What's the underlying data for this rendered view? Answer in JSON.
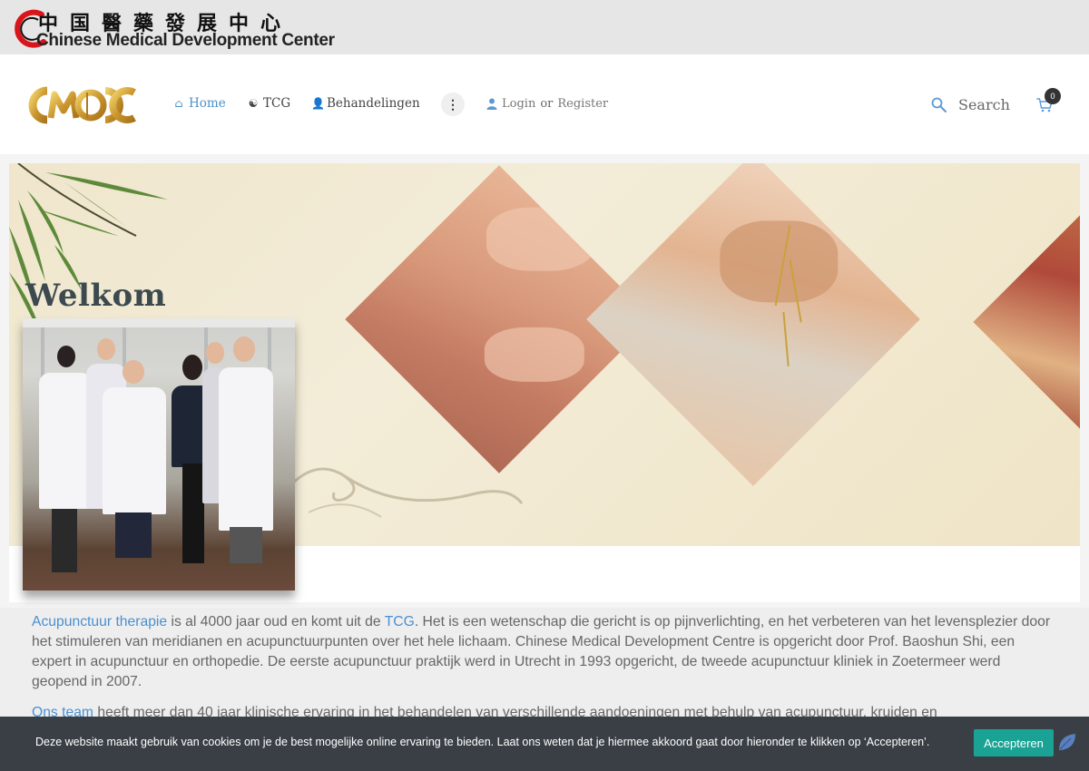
{
  "topbar": {
    "chinese_name": "中国醫藥發展中心",
    "english_name": "Chinese Medical Development Center"
  },
  "nav": {
    "logo_text": "CMDC",
    "items": [
      {
        "label": "Home",
        "icon": "home-icon",
        "active": true
      },
      {
        "label": "TCG",
        "icon": "yin-yang-icon",
        "active": false
      },
      {
        "label": "Behandelingen",
        "icon": "user-icon",
        "active": false
      }
    ],
    "more_icon": "vertical-dots-icon",
    "login_label": "Login",
    "or_label": "or",
    "register_label": "Register",
    "search_label": "Search",
    "cart_count": "0"
  },
  "hero": {
    "welcome_title": "Welkom"
  },
  "content": {
    "para1_link1": "Acupunctuur therapie",
    "para1_text1": " is al 4000 jaar oud en komt uit de ",
    "para1_link2": "TCG",
    "para1_text2": ". Het is een wetenschap die gericht is op pijnverlichting, en het verbeteren van het levensplezier door het stimuleren van meridianen en acupunctuurpunten over het hele lichaam. Chinese Medical Development Centre is opgericht door Prof. Baoshun Shi, een expert in acupunctuur en orthopedie. De eerste acupunctuur praktijk werd in Utrecht in 1993 opgericht,  de tweede acupunctuur kliniek in Zoetermeer werd geopend in 2007.",
    "para2_link": "Ons team",
    "para2_text": " heeft meer dan 40 jaar klinische ervaring in het behandelen van verschillende aandoeningen met behulp van acupunctuur, kruiden en"
  },
  "cookie": {
    "message": "Deze website maakt gebruik van cookies om je de best mogelijke online ervaring te bieden. Laat ons weten dat je hiermee akkoord gaat door hieronder te klikken op ‘Accepteren’.",
    "accept_label": "Accepteren"
  },
  "colors": {
    "accent": "#4a90c8",
    "cookie_bg": "#3a3f45",
    "cookie_btn": "#1aa394",
    "brand_red": "#d9141b"
  }
}
